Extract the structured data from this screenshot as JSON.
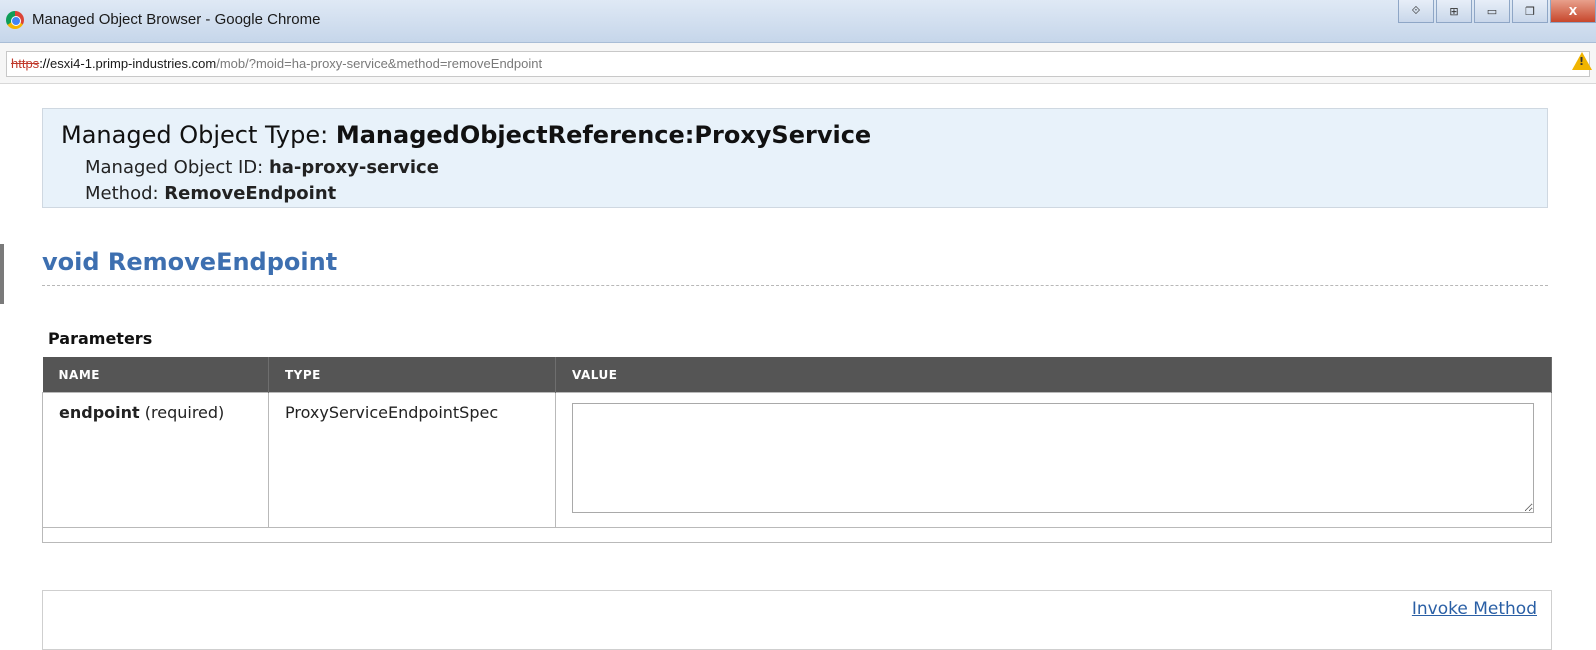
{
  "window": {
    "title": "Managed Object Browser - Google Chrome",
    "controls": [
      "⟐",
      "⊞",
      "▭",
      "❐",
      "X"
    ]
  },
  "address": {
    "scheme": "https",
    "scheme_sep": "://",
    "host": "esxi4-1.primp-industries.com",
    "path": "/mob/?moid=ha-proxy-service&method=removeEndpoint",
    "security_icon": "warning-icon"
  },
  "header": {
    "type_label": "Managed Object Type: ",
    "type_value": "ManagedObjectReference:ProxyService",
    "id_label": "Managed Object ID: ",
    "id_value": "ha-proxy-service",
    "method_label": "Method: ",
    "method_value": "RemoveEndpoint"
  },
  "method_title": "void RemoveEndpoint",
  "parameters": {
    "heading": "Parameters",
    "columns": [
      "NAME",
      "TYPE",
      "VALUE"
    ],
    "rows": [
      {
        "name": "endpoint",
        "qualifier": " (required)",
        "type": "ProxyServiceEndpointSpec",
        "value": ""
      }
    ]
  },
  "invoke_label": "Invoke Method",
  "colors": {
    "header_bg": "#e8f2fa",
    "title_blue": "#3d6fb0",
    "table_header_bg": "#555555",
    "link_blue": "#2a5fa5"
  }
}
